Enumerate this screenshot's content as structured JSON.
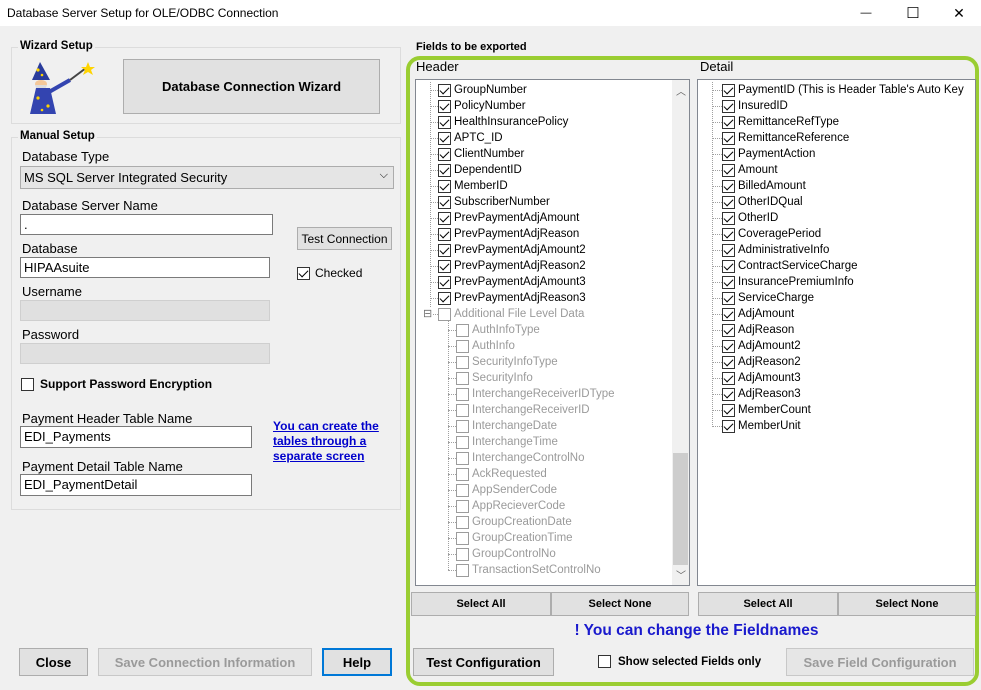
{
  "window": {
    "title": "Database Server Setup for OLE/ODBC Connection",
    "minimize_glyph": "—",
    "maximize_glyph": "☐",
    "close_glyph": "✕"
  },
  "wizard": {
    "group_label": "Wizard Setup",
    "button_label": "Database Connection Wizard",
    "icon": "wizard-icon"
  },
  "manual": {
    "group_label": "Manual Setup",
    "db_type_label": "Database Type",
    "db_type_value": "MS SQL Server Integrated Security",
    "server_name_label": "Database Server Name",
    "server_name_value": ".",
    "database_label": "Database",
    "database_value": "HIPAAsuite",
    "username_label": "Username",
    "username_value": "",
    "password_label": "Password",
    "password_value": "",
    "test_connection_label": "Test Connection",
    "checked_label": "Checked",
    "checked": true,
    "encryption_label": "Support Password Encryption",
    "encryption_checked": false,
    "header_table_label": "Payment Header Table Name",
    "header_table_value": "EDI_Payments",
    "detail_table_label": "Payment Detail Table Name",
    "detail_table_value": "EDI_PaymentDetail",
    "create_tables_link": "You can create the tables through a separate screen"
  },
  "bottom_left": {
    "close_label": "Close",
    "save_connection_label": "Save Connection Information",
    "help_label": "Help"
  },
  "fields": {
    "section_label": "Fields to be exported",
    "header_label": "Header",
    "detail_label": "Detail",
    "header_items": [
      {
        "label": "GroupNumber",
        "checked": true,
        "enabled": true,
        "level": 1
      },
      {
        "label": "PolicyNumber",
        "checked": true,
        "enabled": true,
        "level": 1
      },
      {
        "label": "HealthInsurancePolicy",
        "checked": true,
        "enabled": true,
        "level": 1
      },
      {
        "label": "APTC_ID",
        "checked": true,
        "enabled": true,
        "level": 1
      },
      {
        "label": "ClientNumber",
        "checked": true,
        "enabled": true,
        "level": 1
      },
      {
        "label": "DependentID",
        "checked": true,
        "enabled": true,
        "level": 1
      },
      {
        "label": "MemberID",
        "checked": true,
        "enabled": true,
        "level": 1
      },
      {
        "label": "SubscriberNumber",
        "checked": true,
        "enabled": true,
        "level": 1
      },
      {
        "label": "PrevPaymentAdjAmount",
        "checked": true,
        "enabled": true,
        "level": 1
      },
      {
        "label": "PrevPaymentAdjReason",
        "checked": true,
        "enabled": true,
        "level": 1
      },
      {
        "label": "PrevPaymentAdjAmount2",
        "checked": true,
        "enabled": true,
        "level": 1
      },
      {
        "label": "PrevPaymentAdjReason2",
        "checked": true,
        "enabled": true,
        "level": 1
      },
      {
        "label": "PrevPaymentAdjAmount3",
        "checked": true,
        "enabled": true,
        "level": 1
      },
      {
        "label": "PrevPaymentAdjReason3",
        "checked": true,
        "enabled": true,
        "level": 1
      },
      {
        "label": "Additional File Level Data",
        "checked": false,
        "enabled": false,
        "level": 1,
        "expander": "⊟"
      },
      {
        "label": "AuthInfoType",
        "checked": false,
        "enabled": false,
        "level": 2
      },
      {
        "label": "AuthInfo",
        "checked": false,
        "enabled": false,
        "level": 2
      },
      {
        "label": "SecurityInfoType",
        "checked": false,
        "enabled": false,
        "level": 2
      },
      {
        "label": "SecurityInfo",
        "checked": false,
        "enabled": false,
        "level": 2
      },
      {
        "label": "InterchangeReceiverIDType",
        "checked": false,
        "enabled": false,
        "level": 2
      },
      {
        "label": "InterchangeReceiverID",
        "checked": false,
        "enabled": false,
        "level": 2
      },
      {
        "label": "InterchangeDate",
        "checked": false,
        "enabled": false,
        "level": 2
      },
      {
        "label": "InterchangeTime",
        "checked": false,
        "enabled": false,
        "level": 2
      },
      {
        "label": "InterchangeControlNo",
        "checked": false,
        "enabled": false,
        "level": 2
      },
      {
        "label": "AckRequested",
        "checked": false,
        "enabled": false,
        "level": 2
      },
      {
        "label": "AppSenderCode",
        "checked": false,
        "enabled": false,
        "level": 2
      },
      {
        "label": "AppRecieverCode",
        "checked": false,
        "enabled": false,
        "level": 2
      },
      {
        "label": "GroupCreationDate",
        "checked": false,
        "enabled": false,
        "level": 2
      },
      {
        "label": "GroupCreationTime",
        "checked": false,
        "enabled": false,
        "level": 2
      },
      {
        "label": "GroupControlNo",
        "checked": false,
        "enabled": false,
        "level": 2
      },
      {
        "label": "TransactionSetControlNo",
        "checked": false,
        "enabled": false,
        "level": 2
      }
    ],
    "detail_items": [
      {
        "label": "PaymentID (This is Header Table's Auto Key",
        "checked": true
      },
      {
        "label": "InsuredID",
        "checked": true
      },
      {
        "label": "RemittanceRefType",
        "checked": true
      },
      {
        "label": "RemittanceReference",
        "checked": true
      },
      {
        "label": "PaymentAction",
        "checked": true
      },
      {
        "label": "Amount",
        "checked": true
      },
      {
        "label": "BilledAmount",
        "checked": true
      },
      {
        "label": "OtherIDQual",
        "checked": true
      },
      {
        "label": "OtherID",
        "checked": true
      },
      {
        "label": "CoveragePeriod",
        "checked": true
      },
      {
        "label": "AdministrativeInfo",
        "checked": true
      },
      {
        "label": "ContractServiceCharge",
        "checked": true
      },
      {
        "label": "InsurancePremiumInfo",
        "checked": true
      },
      {
        "label": "ServiceCharge",
        "checked": true
      },
      {
        "label": "AdjAmount",
        "checked": true
      },
      {
        "label": "AdjReason",
        "checked": true
      },
      {
        "label": "AdjAmount2",
        "checked": true
      },
      {
        "label": "AdjReason2",
        "checked": true
      },
      {
        "label": "AdjAmount3",
        "checked": true
      },
      {
        "label": "AdjReason3",
        "checked": true
      },
      {
        "label": "MemberCount",
        "checked": true
      },
      {
        "label": "MemberUnit",
        "checked": true
      }
    ],
    "header_select_all": "Select All",
    "header_select_none": "Select None",
    "detail_select_all": "Select All",
    "detail_select_none": "Select None",
    "rename_notice": "! You can change the Fieldnames",
    "test_configuration_label": "Test Configuration",
    "show_selected_label": "Show selected Fields only",
    "show_selected_checked": false,
    "save_field_label": "Save Field Configuration"
  },
  "colors": {
    "highlight_border": "#9acd32",
    "link": "#0000cc",
    "notice": "#1a1acd",
    "focus_border": "#0078d7"
  }
}
